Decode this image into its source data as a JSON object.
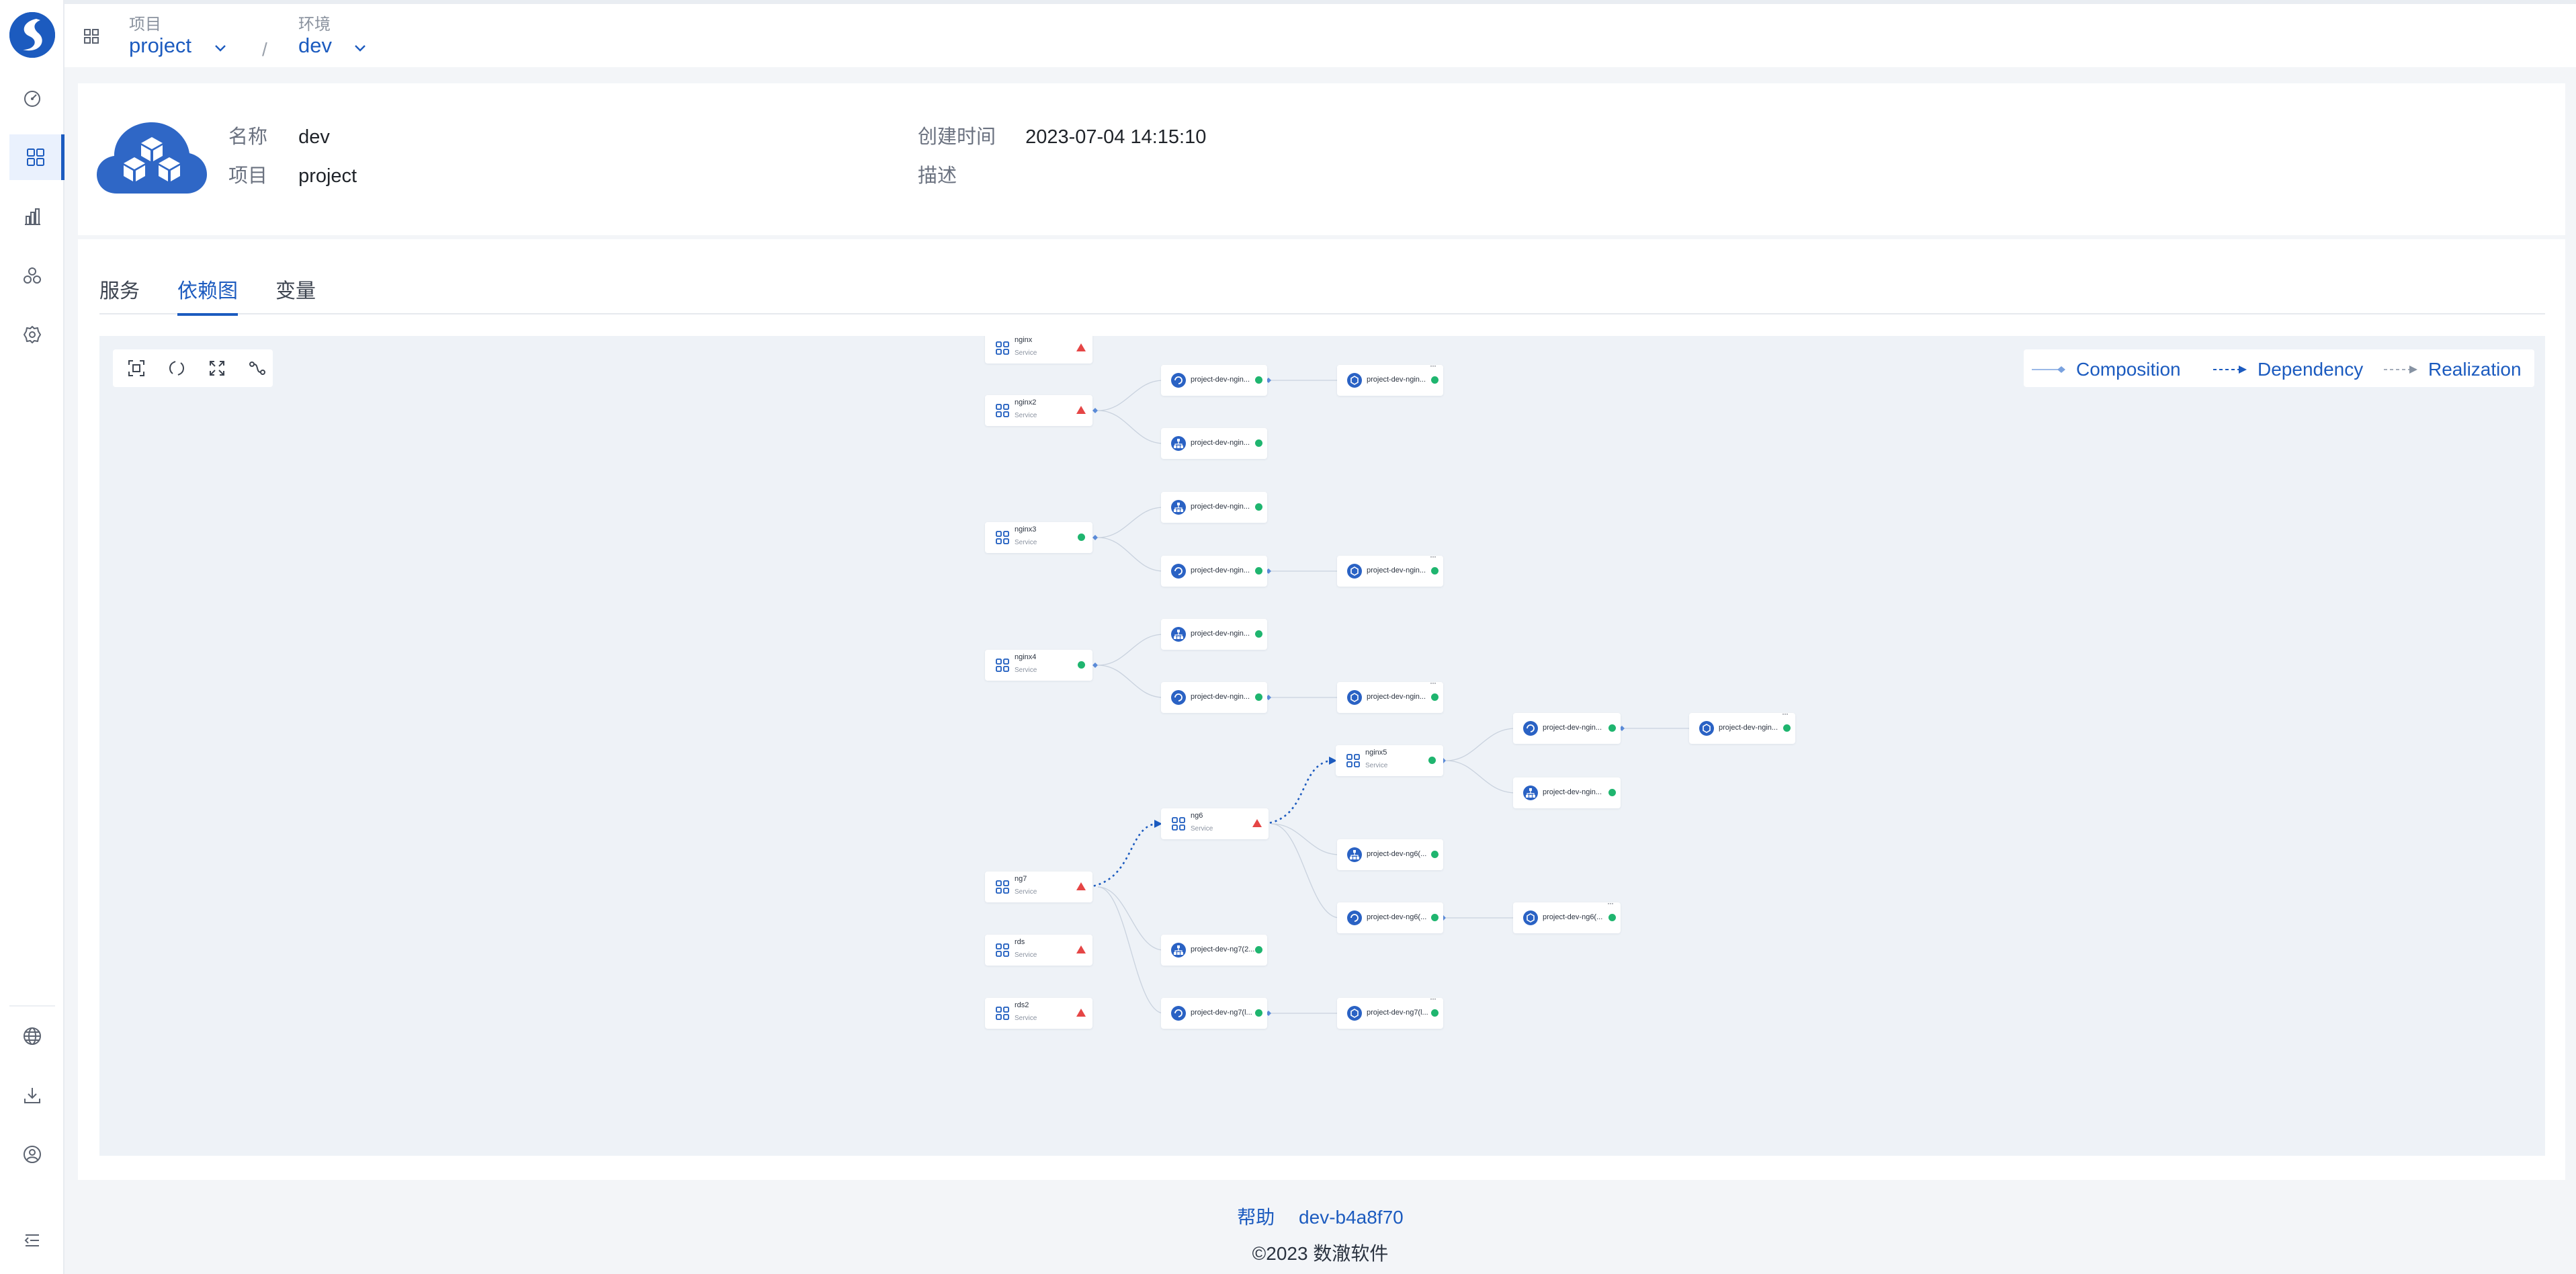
{
  "topbar": {
    "project_caption": "项目",
    "project_value": "project",
    "env_caption": "环境",
    "env_value": "dev",
    "separator": "/"
  },
  "info": {
    "name_label": "名称",
    "name_value": "dev",
    "project_label": "项目",
    "project_value": "project",
    "created_label": "创建时间",
    "created_value": "2023-07-04 14:15:10",
    "desc_label": "描述",
    "desc_value": ""
  },
  "tabs": [
    {
      "label": "服务"
    },
    {
      "label": "依赖图"
    },
    {
      "label": "变量"
    }
  ],
  "legend": {
    "composition": "Composition",
    "dependency": "Dependency",
    "realization": "Realization"
  },
  "graph": {
    "nodes": [
      {
        "id": "nginx",
        "name": "nginx",
        "sub": "Service",
        "status": "warn"
      },
      {
        "id": "nginx2",
        "name": "nginx2",
        "sub": "Service",
        "status": "warn"
      },
      {
        "id": "nginx3",
        "name": "nginx3",
        "sub": "Service",
        "status": "ok"
      },
      {
        "id": "nginx4",
        "name": "nginx4",
        "sub": "Service",
        "status": "ok"
      },
      {
        "id": "nginx5",
        "name": "nginx5",
        "sub": "Service",
        "status": "ok"
      },
      {
        "id": "ng6",
        "name": "ng6",
        "sub": "Service",
        "status": "warn"
      },
      {
        "id": "ng7",
        "name": "ng7",
        "sub": "Service",
        "status": "warn"
      },
      {
        "id": "rds",
        "name": "rds",
        "sub": "Service",
        "status": "warn"
      },
      {
        "id": "rds2",
        "name": "rds2",
        "sub": "Service",
        "status": "warn"
      },
      {
        "id": "r1a",
        "name": "project-dev-ngin...",
        "status": "ok"
      },
      {
        "id": "r1b",
        "name": "project-dev-ngin...",
        "status": "ok"
      },
      {
        "id": "r2",
        "name": "project-dev-ngin...",
        "status": "ok"
      },
      {
        "id": "r3",
        "name": "project-dev-ngin...",
        "status": "ok"
      },
      {
        "id": "r4a",
        "name": "project-dev-ngin...",
        "status": "ok"
      },
      {
        "id": "r4b",
        "name": "project-dev-ngin...",
        "status": "ok"
      },
      {
        "id": "r5",
        "name": "project-dev-ngin...",
        "status": "ok"
      },
      {
        "id": "r6a",
        "name": "project-dev-ngin...",
        "status": "ok"
      },
      {
        "id": "r6b",
        "name": "project-dev-ngin...",
        "status": "ok"
      },
      {
        "id": "r7a",
        "name": "project-dev-ngin...",
        "status": "ok"
      },
      {
        "id": "r7b",
        "name": "project-dev-ngin...",
        "status": "ok"
      },
      {
        "id": "r8",
        "name": "project-dev-ngin...",
        "status": "ok"
      },
      {
        "id": "r9",
        "name": "project-dev-ng6(...",
        "status": "ok"
      },
      {
        "id": "r10a",
        "name": "project-dev-ng6(...",
        "status": "ok"
      },
      {
        "id": "r10b",
        "name": "project-dev-ng6(...",
        "status": "ok"
      },
      {
        "id": "r11",
        "name": "project-dev-ng7(2...",
        "status": "ok"
      },
      {
        "id": "r12a",
        "name": "project-dev-ng7(l...",
        "status": "ok"
      },
      {
        "id": "r12b",
        "name": "project-dev-ng7(l...",
        "status": "ok"
      }
    ]
  },
  "footer": {
    "help": "帮助",
    "version": "dev-b4a8f70",
    "copyright": "©2023 数澈软件"
  },
  "colors": {
    "primary": "#1c5bbf",
    "ok": "#1fb56f",
    "warn": "#e54545",
    "canvas": "#eef2f7"
  }
}
